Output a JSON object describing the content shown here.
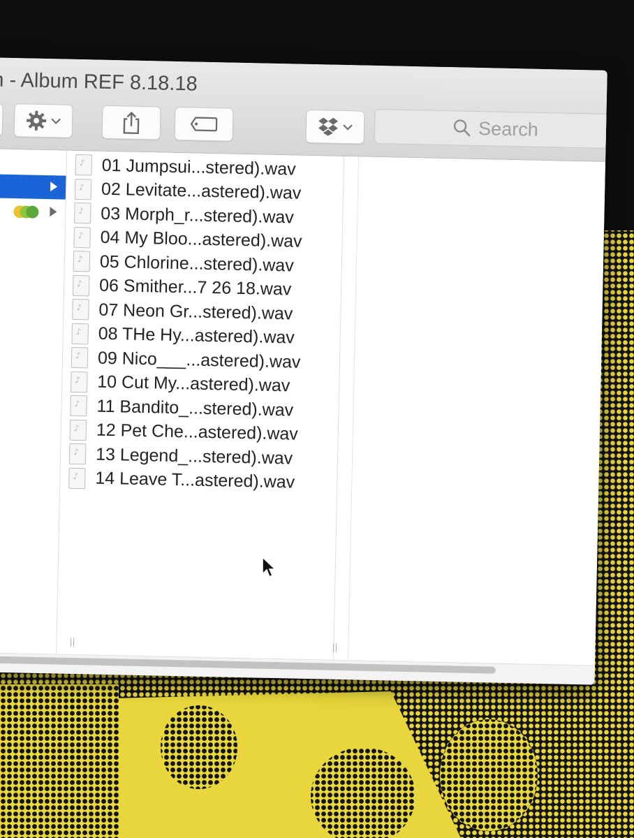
{
  "window": {
    "title": "n - Album REF 8.18.18"
  },
  "toolbar": {
    "buttons": [
      {
        "name": "view-options-button",
        "icon": "chevron-down-icon"
      },
      {
        "name": "action-button",
        "icon": "gear-icon"
      },
      {
        "name": "share-button",
        "icon": "share-icon"
      },
      {
        "name": "tags-button",
        "icon": "tag-icon"
      },
      {
        "name": "dropbox-button",
        "icon": "dropbox-icon"
      }
    ],
    "search_placeholder": "Search"
  },
  "sidebar": {
    "tag_colors": [
      "#e9c230",
      "#8ec63f",
      "#5aa83a"
    ],
    "selected_color": "#1a64d8"
  },
  "files": [
    "01 Jumpsui...stered).wav",
    "02 Levitate...astered).wav",
    "03 Morph_r...stered).wav",
    "04 My Bloo...astered).wav",
    "05 Chlorine...stered).wav",
    "06 Smither...7 26 18.wav",
    "07 Neon Gr...stered).wav",
    "08 THe Hy...astered).wav",
    "09 Nico___...astered).wav",
    "10 Cut My...astered).wav",
    "11 Bandito_...stered).wav",
    "12 Pet Che...astered).wav",
    "13 Legend_...stered).wav",
    "14 Leave T...astered).wav"
  ]
}
